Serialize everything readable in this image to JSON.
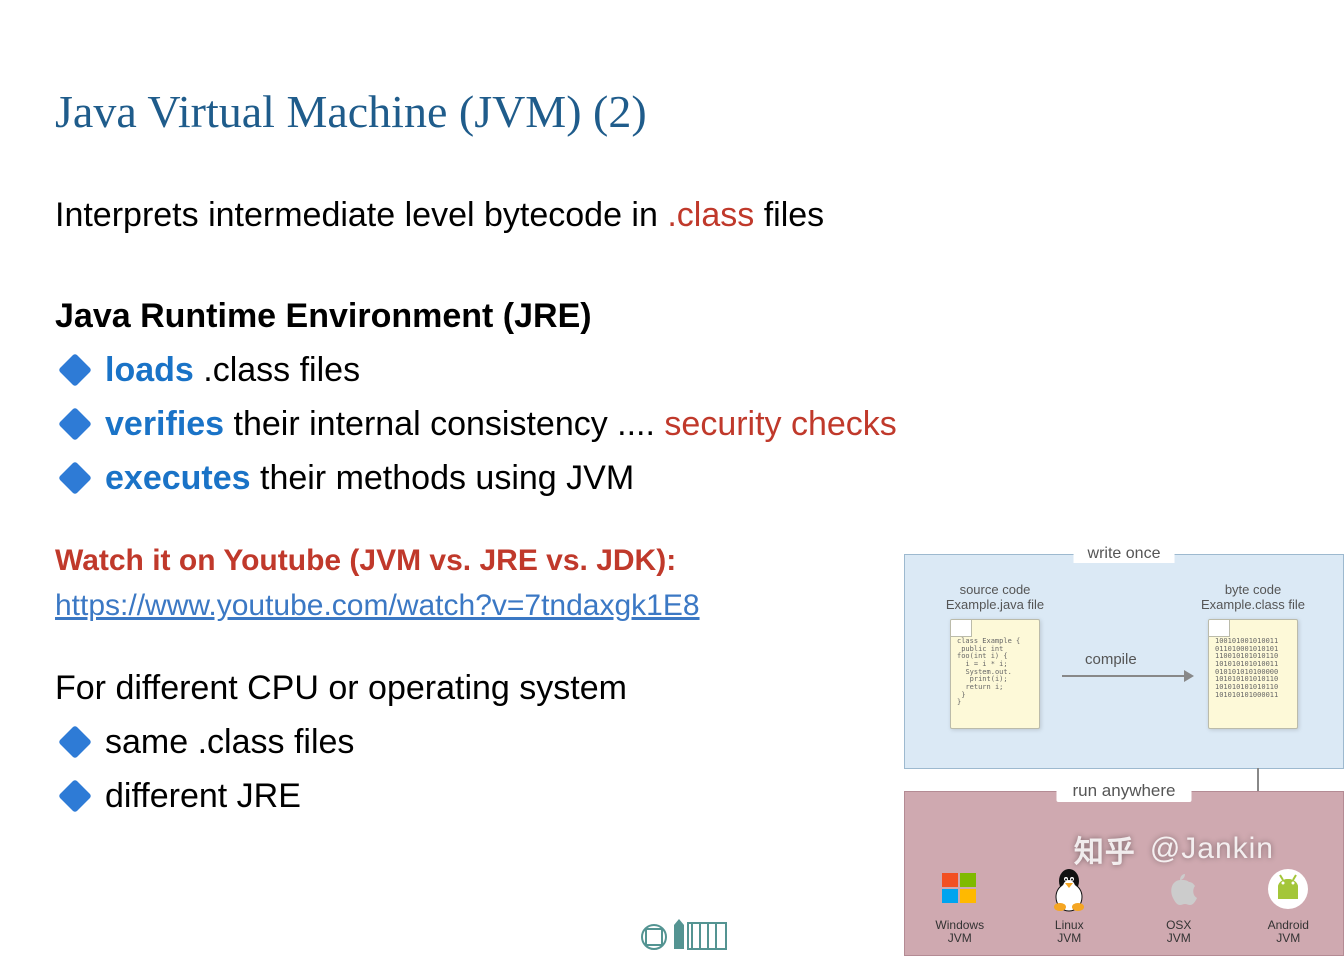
{
  "title": "Java Virtual Machine (JVM) (2)",
  "intro": {
    "prefix": "Interprets intermediate level bytecode in ",
    "highlight": ".class",
    "suffix": " files"
  },
  "jre": {
    "heading": "Java Runtime Environment (JRE)",
    "items": [
      {
        "key": "loads",
        "rest": " .class files",
        "red": ""
      },
      {
        "key": "verifies",
        "rest": " their internal consistency .... ",
        "red": "security checks"
      },
      {
        "key": "executes",
        "rest": " their methods using JVM",
        "red": ""
      }
    ]
  },
  "watch": {
    "label": "Watch it on Youtube (JVM vs. JRE vs. JDK):",
    "url": "https://www.youtube.com/watch?v=7tndaxgk1E8"
  },
  "cpu": {
    "heading": "For different CPU or operating system",
    "items": [
      "same .class files",
      "different JRE"
    ]
  },
  "diagram": {
    "top_label": "write once",
    "source": {
      "caption1": "source code",
      "caption2": "Example.java file",
      "content": "class Example {\n public int foo(int i) {\n  i = i * i;\n  System.out.\n   print(i);\n  return i;\n }\n}"
    },
    "compile": "compile",
    "bytecode": {
      "caption1": "byte code",
      "caption2": "Example.class file",
      "content": "100101001010011\n011010001010101\n110010101010110\n101010101010011\n010101010100000\n101010101010110\n101010101010110\n101010101000011"
    },
    "bottom_label": "run anywhere",
    "jvms": [
      {
        "name": "Windows",
        "sub": "JVM"
      },
      {
        "name": "Linux",
        "sub": "JVM"
      },
      {
        "name": "OSX",
        "sub": "JVM"
      },
      {
        "name": "Android",
        "sub": "JVM"
      }
    ]
  },
  "watermark": {
    "site": "知乎",
    "handle": "@Jankin"
  }
}
